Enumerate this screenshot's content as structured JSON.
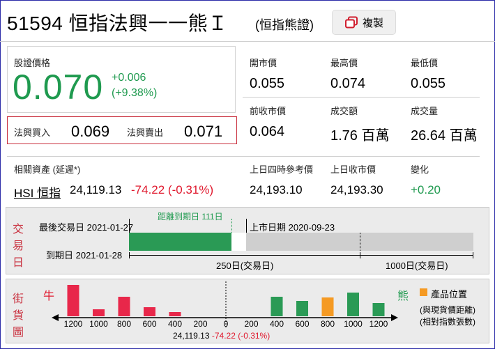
{
  "header": {
    "code_title": "51594 恒指法興一一熊Ｉ",
    "subtitle": "(恒指熊證)",
    "copy_label": "複製"
  },
  "price": {
    "label": "股證價格",
    "value": "0.070",
    "change": "+0.006",
    "change_pct": "(+9.38%)"
  },
  "bidask": {
    "bid_label": "法興買入",
    "bid": "0.069",
    "ask_label": "法興賣出",
    "ask": "0.071"
  },
  "stats": [
    {
      "label": "開市價",
      "value": "0.055"
    },
    {
      "label": "最高價",
      "value": "0.074"
    },
    {
      "label": "最低價",
      "value": "0.055"
    },
    {
      "label": "前收市價",
      "value": "0.064"
    },
    {
      "label": "成交額",
      "value": "1.76 百萬"
    },
    {
      "label": "成交量",
      "value": "26.64 百萬"
    }
  ],
  "underlying": {
    "label": "相關資產 (延遲*)",
    "name": "HSI 恒指",
    "price": "24,119.13",
    "change": "-74.22 (-0.31%)",
    "ref_label": "上日四時參考價",
    "ref_value": "24,193.10",
    "prev_close_label": "上日收市價",
    "prev_close_value": "24,193.30",
    "change_label": "變化",
    "change_value": "+0.20"
  },
  "trading_days": {
    "section_title": "交易日",
    "last_trade_label": "最後交易日 2021-01-27",
    "days_to_expiry_label": "距離到期日 111日",
    "listing_label": "上市日期 2020-09-23",
    "expiry_label": "到期日 2021-01-28",
    "axis1_label": "250日(交易日)",
    "axis2_label": "1000日(交易日)",
    "days_to_expiry": 111,
    "axis1_days": 250,
    "axis2_days": 1000
  },
  "street": {
    "section_title": "街貨圖",
    "bull_label": "牛",
    "bear_label": "熊",
    "legend_label": "產品位置",
    "note1": "(與現貨價距離)",
    "note2": "(相對指數張數)",
    "center_price": "24,119.13",
    "center_change": "-74.22 (-0.31%)",
    "colors": {
      "bull": "#e8274a",
      "bear": "#2a9a55",
      "position": "#f59a23"
    }
  },
  "chart_data": {
    "type": "bar",
    "categories": [
      "1200",
      "1000",
      "800",
      "600",
      "400",
      "200",
      "0",
      "200",
      "400",
      "600",
      "800",
      "1000",
      "1200"
    ],
    "series": [
      {
        "name": "牛",
        "values": [
          45,
          10,
          28,
          13,
          6,
          0,
          0,
          0,
          0,
          0,
          0,
          0,
          0
        ]
      },
      {
        "name": "熊",
        "values": [
          0,
          0,
          0,
          0,
          0,
          0,
          0,
          0,
          28,
          22,
          0,
          34,
          19
        ]
      },
      {
        "name": "產品位置",
        "values": [
          0,
          0,
          0,
          0,
          0,
          0,
          0,
          0,
          0,
          0,
          27,
          0,
          0
        ]
      }
    ],
    "xlabel": "",
    "ylabel": ""
  }
}
